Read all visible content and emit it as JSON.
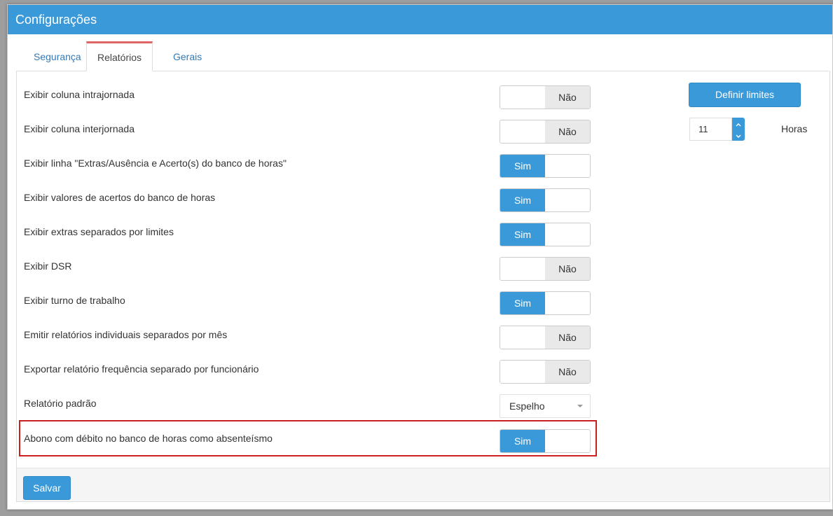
{
  "window": {
    "title": "Configurações"
  },
  "tabs": [
    {
      "label": "Segurança",
      "active": false
    },
    {
      "label": "Relatórios",
      "active": true
    },
    {
      "label": "Gerais",
      "active": false
    }
  ],
  "toggle_labels": {
    "on": "Sim",
    "off": "Não"
  },
  "rows": [
    {
      "label": "Exibir coluna intrajornada",
      "value": "Não"
    },
    {
      "label": "Exibir coluna interjornada",
      "value": "Não"
    },
    {
      "label": "Exibir linha \"Extras/Ausência e Acerto(s) do banco de horas\"",
      "value": "Sim"
    },
    {
      "label": "Exibir valores de acertos do banco de horas",
      "value": "Sim"
    },
    {
      "label": "Exibir extras separados por limites",
      "value": "Sim"
    },
    {
      "label": "Exibir DSR",
      "value": "Não"
    },
    {
      "label": "Exibir turno de trabalho",
      "value": "Sim"
    },
    {
      "label": "Emitir relatórios individuais separados por mês",
      "value": "Não"
    },
    {
      "label": "Exportar relatório frequência separado por funcionário",
      "value": "Não"
    },
    {
      "label": "Relatório padrão",
      "select_value": "Espelho"
    },
    {
      "label": "Abono com débito no banco de horas como absenteísmo",
      "value": "Sim",
      "highlighted": true
    }
  ],
  "side": {
    "limits_button": "Definir limites",
    "hours_value": "11",
    "hours_label": "Horas"
  },
  "footer": {
    "save_button": "Salvar"
  },
  "colors": {
    "primary": "#3a9ad9",
    "highlight_border": "#cc1f1f",
    "active_tab_border": "#e06666"
  }
}
